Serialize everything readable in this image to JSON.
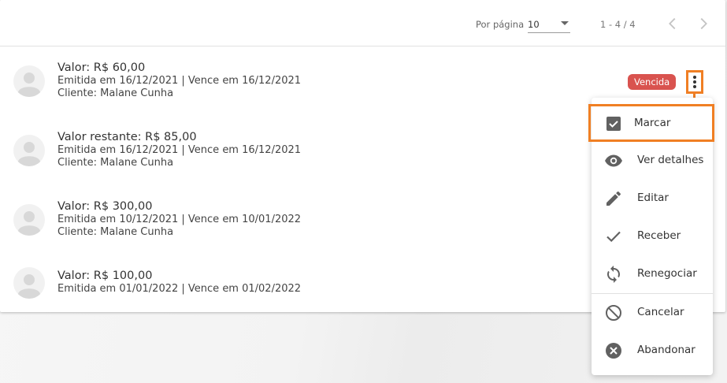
{
  "pagination": {
    "per_page_label": "Por página",
    "per_page_value": "10",
    "range": "1 - 4 / 4",
    "prev_icon": "chevron-left-icon",
    "next_icon": "chevron-right-icon"
  },
  "items": [
    {
      "amount": "Valor: R$ 60,00",
      "dates": "Emitida em 16/12/2021 | Vence em 16/12/2021",
      "client": "Cliente: Malane Cunha",
      "status": "Vencida"
    },
    {
      "amount": "Valor restante: R$ 85,00",
      "dates": "Emitida em 16/12/2021 | Vence em 16/12/2021",
      "client": "Cliente: Malane Cunha"
    },
    {
      "amount": "Valor: R$ 300,00",
      "dates": "Emitida em 10/12/2021 | Vence em 10/01/2022",
      "client": "Cliente: Malane Cunha"
    },
    {
      "amount": "Valor: R$ 100,00",
      "dates": "Emitida em 01/01/2022 | Vence em 01/02/2022"
    }
  ],
  "menu": {
    "items": [
      {
        "label": "Marcar",
        "icon": "checkbox-checked-icon"
      },
      {
        "label": "Ver detalhes",
        "icon": "eye-icon"
      },
      {
        "label": "Editar",
        "icon": "pencil-icon"
      },
      {
        "label": "Receber",
        "icon": "check-icon"
      },
      {
        "label": "Renegociar",
        "icon": "sync-icon"
      },
      {
        "label": "Cancelar",
        "icon": "block-icon"
      },
      {
        "label": "Abandonar",
        "icon": "cancel-circle-icon"
      }
    ]
  },
  "colors": {
    "highlight": "#f07f24",
    "badge": "#d9534f",
    "icon": "#616161"
  }
}
